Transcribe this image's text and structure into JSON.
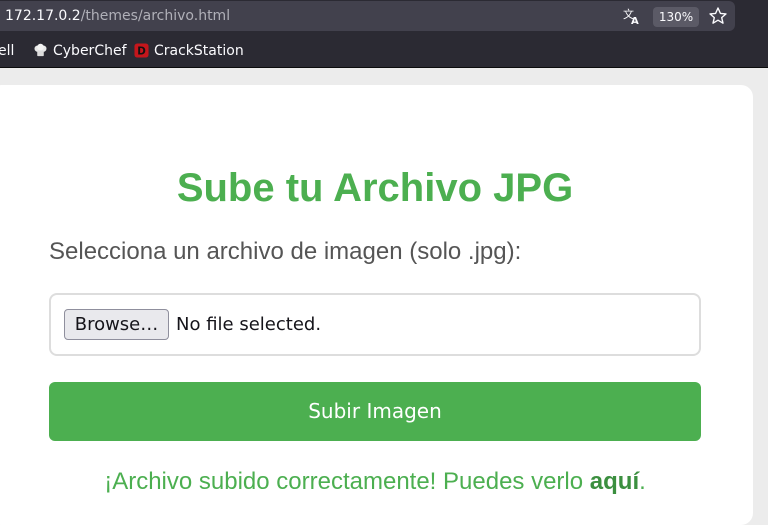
{
  "browser": {
    "url_host": "172.17.0.2",
    "url_path": "/themes/archivo.html",
    "zoom": "130%",
    "icons": [
      "translate-icon",
      "star-icon"
    ],
    "bookmarks": [
      {
        "label": "ell",
        "icon": ""
      },
      {
        "label": "CyberChef",
        "icon": "chef-hat-icon"
      },
      {
        "label": "CrackStation",
        "icon": "crackstation-d-icon"
      }
    ]
  },
  "page": {
    "title": "Sube tu Archivo JPG",
    "label": "Selecciona un archivo de imagen (solo .jpg):",
    "file_input": {
      "button_label": "Browse…",
      "status": "No file selected."
    },
    "submit_label": "Subir Imagen",
    "message_text": "¡Archivo subido correctamente! Puedes verlo ",
    "message_link": "aquí",
    "message_end": "."
  },
  "colors": {
    "accent": "#4caf50",
    "chrome_bg": "#2b2a33",
    "urlbar_bg": "#42414d",
    "label_text": "#555555"
  }
}
